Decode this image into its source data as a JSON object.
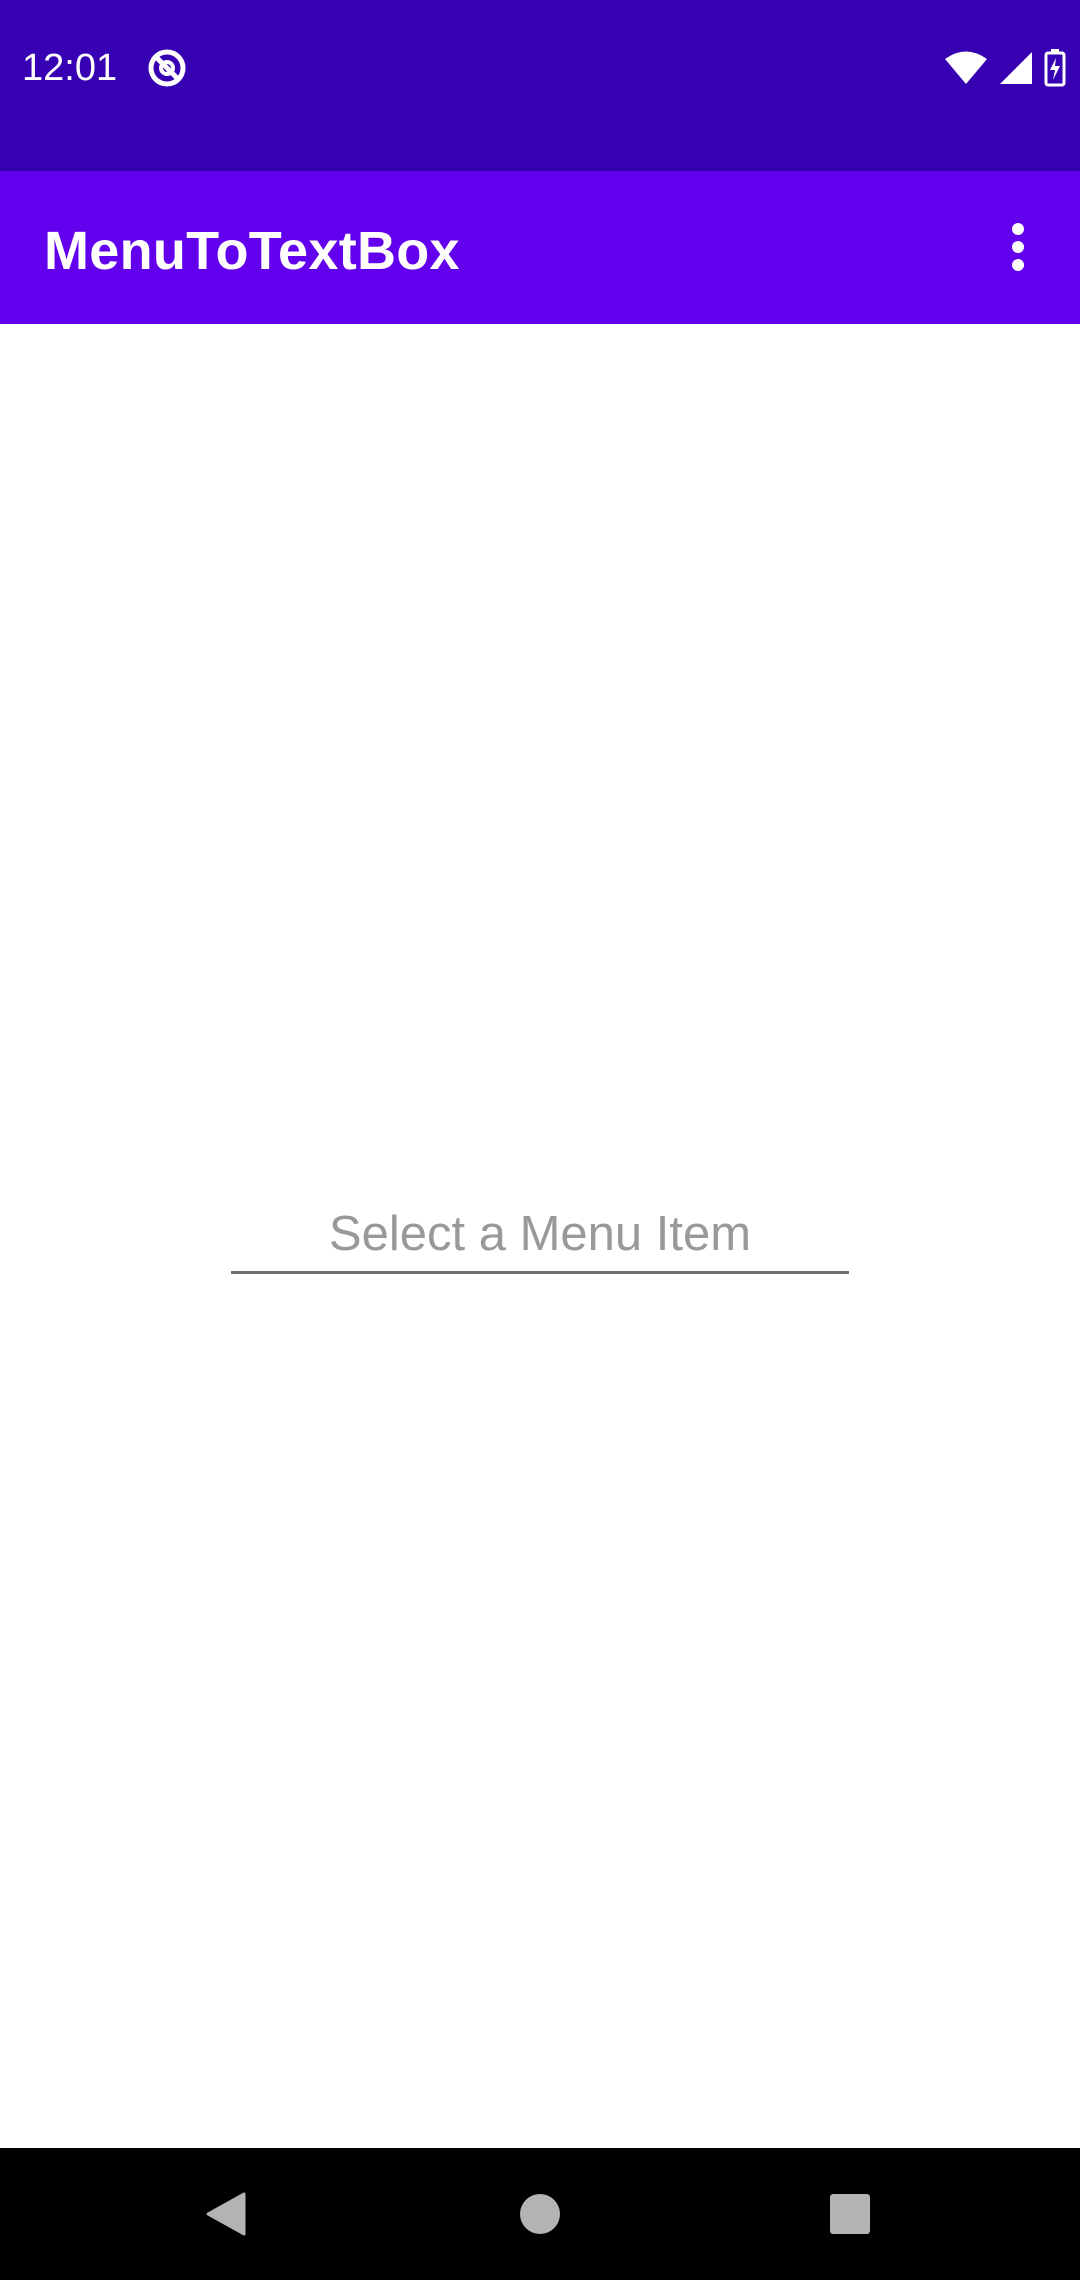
{
  "status_bar": {
    "time": "12:01",
    "icons": [
      "app-notification-icon",
      "wifi-icon",
      "cell-signal-icon",
      "battery-charging-icon"
    ],
    "color": "#3700b3"
  },
  "app_bar": {
    "title": "MenuToTextBox",
    "overflow_icon": "more-vert-icon",
    "color": "#6200ee"
  },
  "main": {
    "text_field": {
      "value": "",
      "placeholder": "Select a Menu Item"
    }
  },
  "nav_bar": {
    "icons": [
      "back-icon",
      "home-icon",
      "recents-icon"
    ]
  }
}
